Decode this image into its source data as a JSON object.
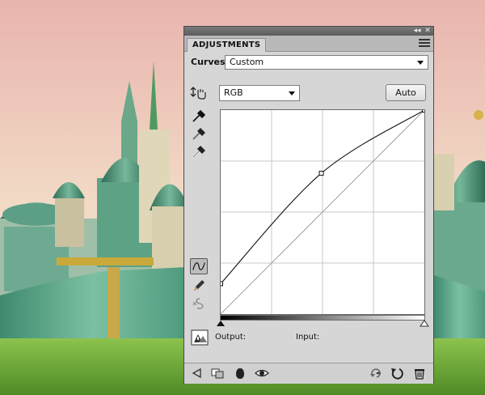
{
  "panel": {
    "tab_label": "ADJUSTMENTS",
    "curves_label": "Curves",
    "preset_value": "Custom",
    "channel_value": "RGB",
    "auto_label": "Auto",
    "output_label": "Output:",
    "input_label": "Input:",
    "collapse_glyph": "◂◂",
    "close_glyph": "✕"
  },
  "curve": {
    "points": [
      [
        0,
        38
      ],
      [
        126,
        176
      ],
      [
        255,
        255
      ]
    ],
    "grid_divisions": 4
  },
  "colors": {
    "panel_bg": "#d6d6d6",
    "sky_top": "#e6b9b1",
    "grass": "#6fa83a",
    "wall": "#5fa68a"
  },
  "icons": [
    "target-adjust-icon",
    "black-eyedropper-icon",
    "gray-eyedropper-icon",
    "white-eyedropper-icon",
    "curve-tool-icon",
    "pencil-icon",
    "smooth-icon",
    "clipping-warning-icon",
    "back-icon",
    "clip-layer-icon",
    "visibility-icon",
    "eye-icon",
    "view-previous-icon",
    "reset-icon",
    "trash-icon"
  ]
}
